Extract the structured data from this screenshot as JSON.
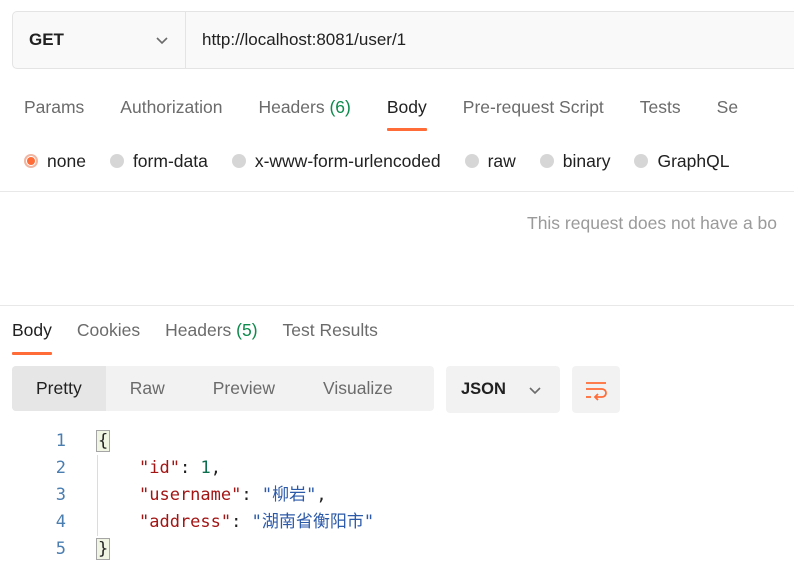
{
  "request": {
    "method": "GET",
    "url": "http://localhost:8081/user/1"
  },
  "request_tabs": [
    {
      "label": "Params"
    },
    {
      "label": "Authorization"
    },
    {
      "label": "Headers",
      "count": "(6)"
    },
    {
      "label": "Body",
      "active": true
    },
    {
      "label": "Pre-request Script"
    },
    {
      "label": "Tests"
    },
    {
      "label": "Se"
    }
  ],
  "body_types": [
    {
      "label": "none",
      "selected": true
    },
    {
      "label": "form-data"
    },
    {
      "label": "x-www-form-urlencoded"
    },
    {
      "label": "raw"
    },
    {
      "label": "binary"
    },
    {
      "label": "GraphQL"
    }
  ],
  "no_body_message": "This request does not have a bo",
  "response_tabs": [
    {
      "label": "Body",
      "active": true
    },
    {
      "label": "Cookies"
    },
    {
      "label": "Headers",
      "count": "(5)"
    },
    {
      "label": "Test Results"
    }
  ],
  "view_modes": [
    {
      "label": "Pretty",
      "active": true
    },
    {
      "label": "Raw"
    },
    {
      "label": "Preview"
    },
    {
      "label": "Visualize"
    }
  ],
  "format": "JSON",
  "icons": {
    "method_dropdown": "chevron-down-icon",
    "format_dropdown": "chevron-down-icon",
    "wrap": "wrap-lines-icon"
  },
  "colors": {
    "accent": "#ff6c37",
    "count": "#0e8a4c",
    "json_key": "#a31515",
    "json_string": "#2d5aa8",
    "json_number": "#0b6e4f"
  },
  "response_body": {
    "line_numbers": [
      "1",
      "2",
      "3",
      "4",
      "5"
    ],
    "open_brace": "{",
    "close_brace": "}",
    "fields": [
      {
        "key": "\"id\"",
        "sep": ": ",
        "value": "1",
        "kind": "num",
        "trail": ","
      },
      {
        "key": "\"username\"",
        "sep": ": ",
        "value": "\"柳岩\"",
        "kind": "str",
        "trail": ","
      },
      {
        "key": "\"address\"",
        "sep": ": ",
        "value": "\"湖南省衡阳市\"",
        "kind": "str",
        "trail": ""
      }
    ]
  }
}
